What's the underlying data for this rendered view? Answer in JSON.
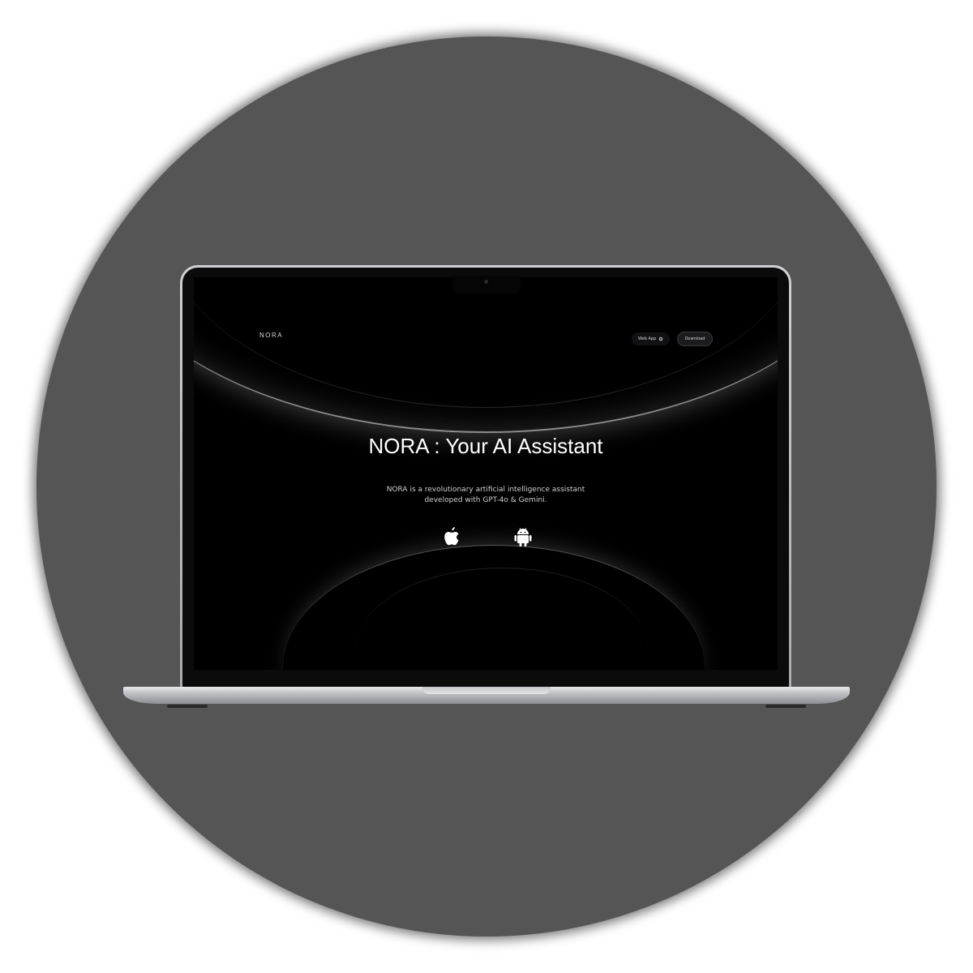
{
  "site": {
    "brand": "NORA",
    "nav": {
      "web_app_label": "Web App",
      "download_label": "Download"
    },
    "hero": {
      "title": "NORA : Your AI Assistant",
      "subtitle_line1": "NORA is a revolutionary artificial intelligence assistant",
      "subtitle_line2": "developed with GPT-4o & Gemini."
    },
    "platform_icons": [
      "apple-icon",
      "android-icon"
    ]
  },
  "colors": {
    "background_circle": "#555555",
    "screen_background": "#000000",
    "text_primary": "#ffffff"
  }
}
